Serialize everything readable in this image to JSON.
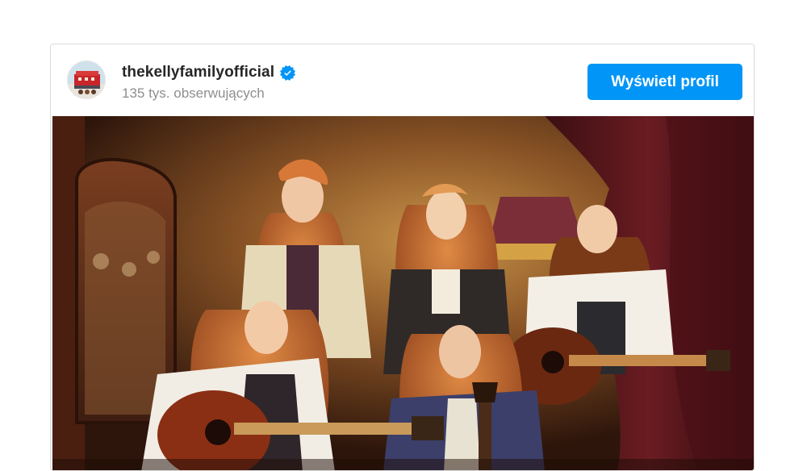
{
  "account": {
    "username": "thekellyfamilyofficial",
    "verified": true,
    "followers": "135 tys. obserwujących"
  },
  "actions": {
    "view_profile_label": "Wyświetl profil"
  },
  "icons": {
    "verified": "verified-badge-icon",
    "avatar": "profile-avatar"
  },
  "colors": {
    "accent": "#0095f6",
    "username": "#262626",
    "secondary_text": "#8e8e8e",
    "border": "#dbdbdb"
  }
}
